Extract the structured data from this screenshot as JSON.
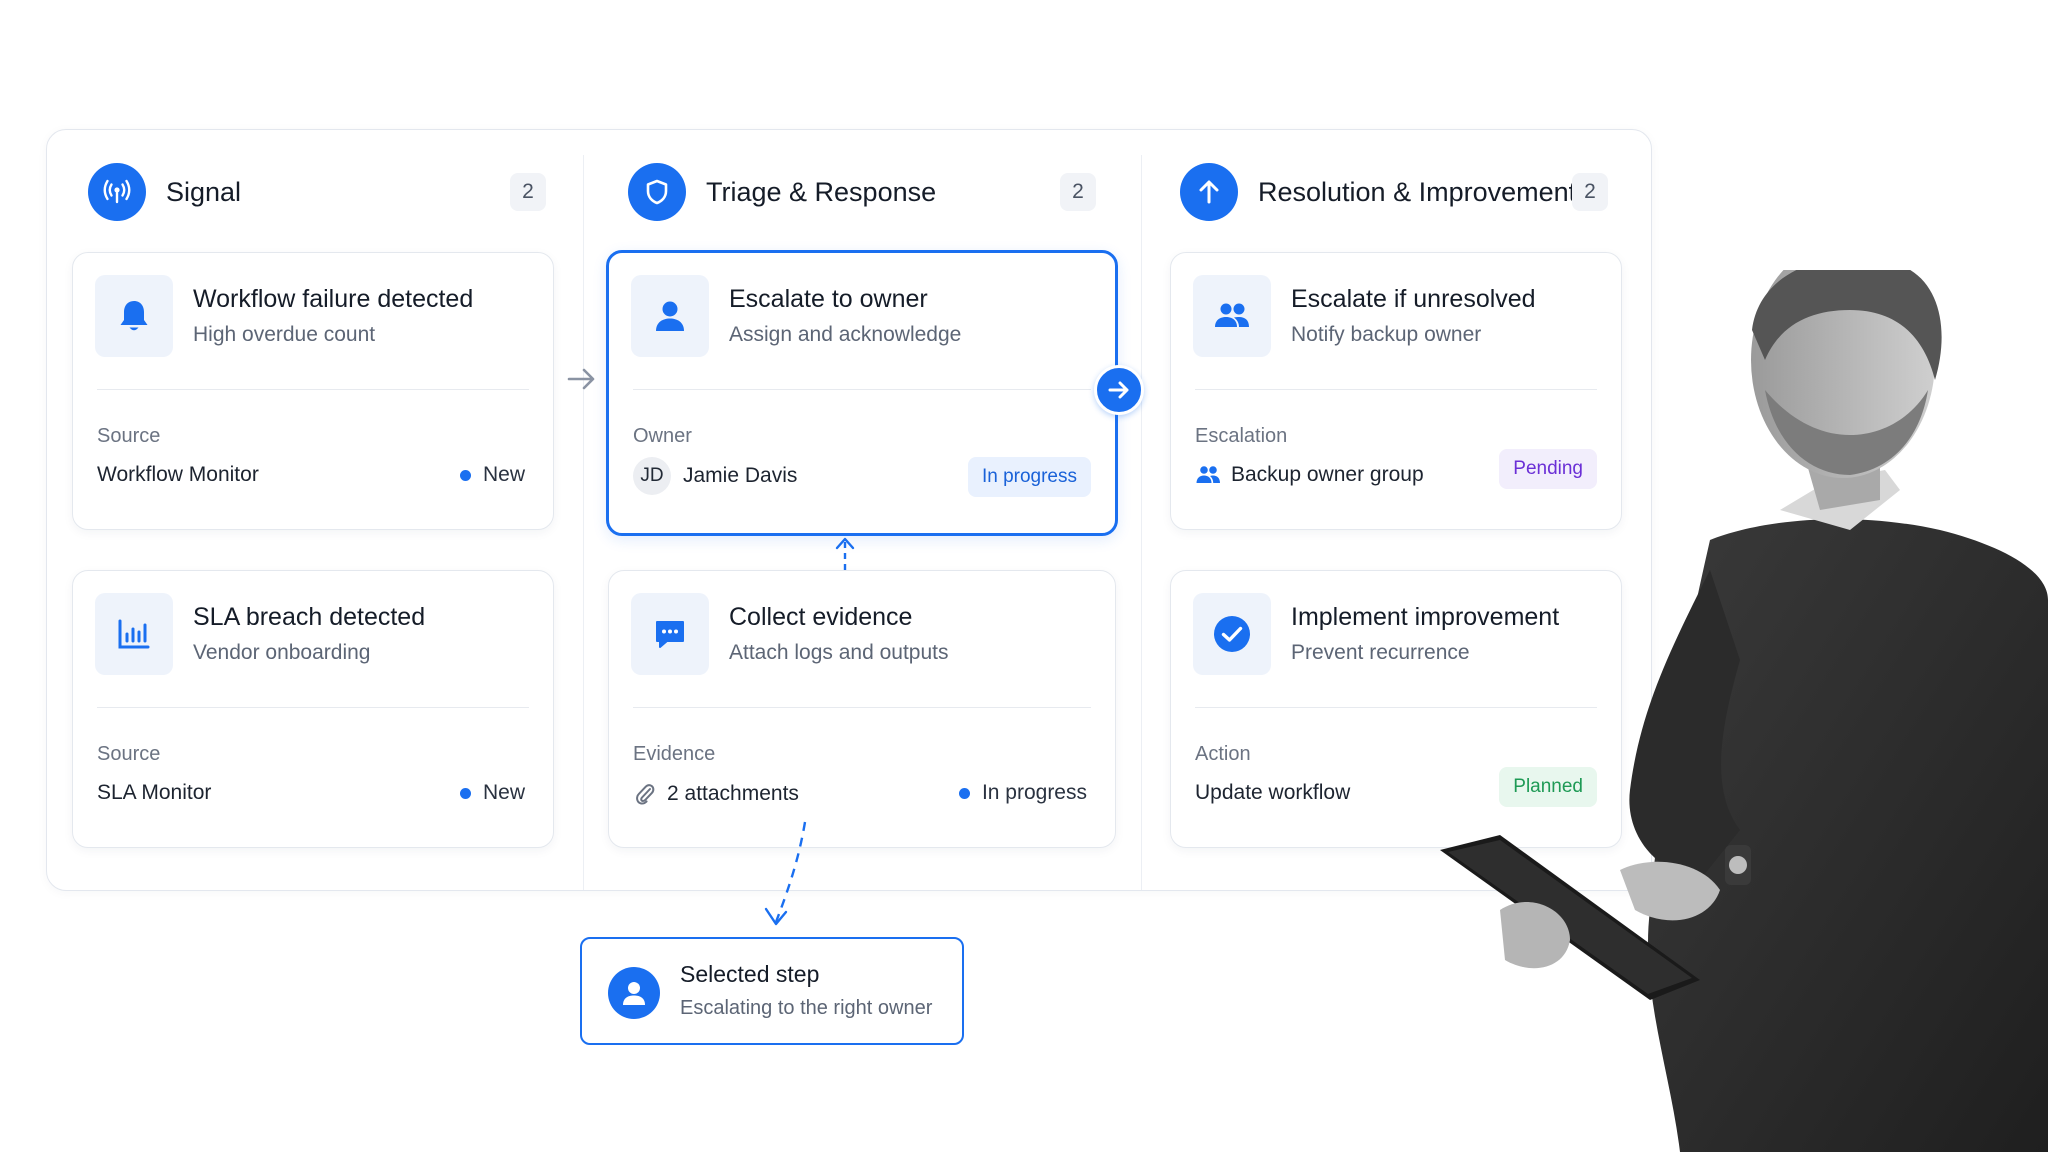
{
  "columns": [
    {
      "title": "Signal",
      "count": "2",
      "icon": "signal-broadcast-icon",
      "cards": [
        {
          "title": "Workflow failure detected",
          "subtitle": "High overdue count",
          "icon": "bell-icon",
          "label": "Source",
          "value": "Workflow Monitor",
          "status": "New"
        },
        {
          "title": "SLA breach detected",
          "subtitle": "Vendor onboarding",
          "icon": "bar-chart-icon",
          "label": "Source",
          "value": "SLA Monitor",
          "status": "New"
        }
      ]
    },
    {
      "title": "Triage & Response",
      "count": "2",
      "icon": "shield-icon",
      "cards": [
        {
          "title": "Escalate to owner",
          "subtitle": "Assign and acknowledge",
          "icon": "user-icon",
          "label": "Owner",
          "avatar": "JD",
          "value": "Jamie Davis",
          "status": "In progress"
        },
        {
          "title": "Collect evidence",
          "subtitle": "Attach logs and outputs",
          "icon": "chat-bubble-icon",
          "label": "Evidence",
          "value": "2 attachments",
          "status": "In progress"
        }
      ]
    },
    {
      "title": "Resolution & Improvement",
      "count": "2",
      "icon": "arrow-up-icon",
      "cards": [
        {
          "title": "Escalate if unresolved",
          "subtitle": "Notify backup owner",
          "icon": "users-icon",
          "label": "Escalation",
          "value": "Backup owner group",
          "status": "Pending"
        },
        {
          "title": "Implement improvement",
          "subtitle": "Prevent recurrence",
          "icon": "check-circle-icon",
          "label": "Action",
          "value": "Update workflow",
          "status": "Planned"
        }
      ]
    }
  ],
  "selected_step": {
    "title": "Selected step",
    "subtitle": "Escalating to the right owner",
    "icon": "user-icon"
  },
  "colors": {
    "accent": "#1a6ff0",
    "pending": "#6b2fd6",
    "planned": "#1e9a55",
    "border": "#e4e8ee"
  }
}
